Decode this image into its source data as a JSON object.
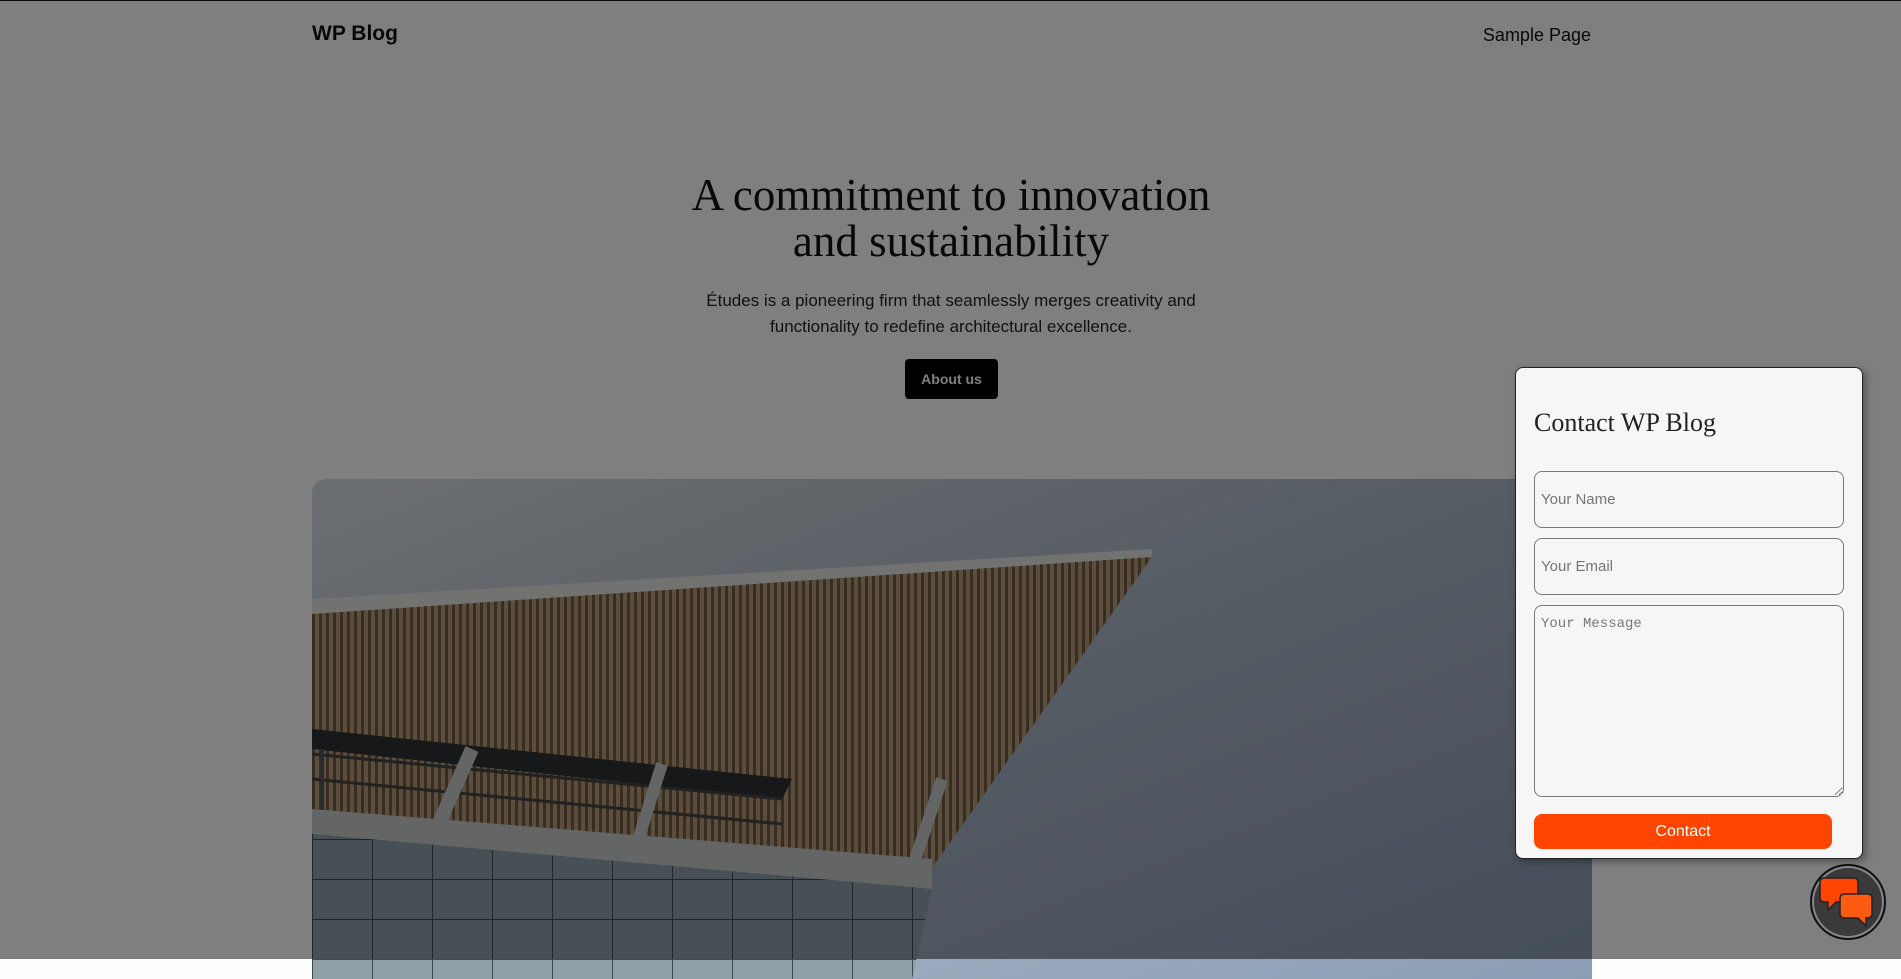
{
  "header": {
    "site_title": "WP Blog",
    "nav": [
      {
        "label": "Sample Page"
      }
    ]
  },
  "hero": {
    "title_line1": "A commitment to innovation",
    "title_line2": "and sustainability",
    "text_line1": "Études is a pioneering firm that seamlessly merges creativity and",
    "text_line2": "functionality to redefine architectural excellence.",
    "button_label": "About us"
  },
  "contact_form": {
    "title": "Contact WP Blog",
    "name_placeholder": "Your Name",
    "email_placeholder": "Your Email",
    "message_placeholder": "Your Message",
    "submit_label": "Contact"
  },
  "colors": {
    "accent": "#ff4500",
    "overlay": "rgba(0,0,0,0.5)",
    "button_dark": "#000000"
  },
  "icons": {
    "chat_toggle": "chat-bubbles-icon"
  }
}
